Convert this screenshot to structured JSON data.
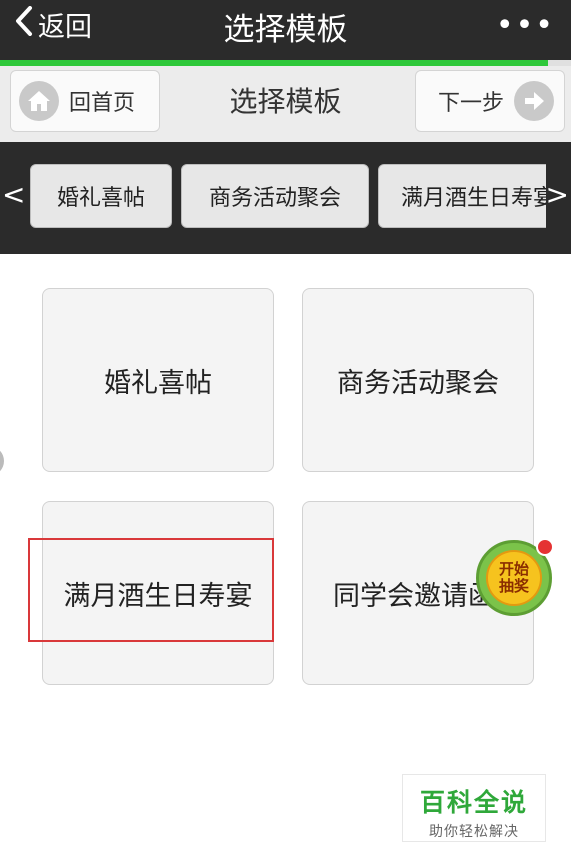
{
  "header": {
    "back_label": "返回",
    "title": "选择模板",
    "more_label": "•••"
  },
  "progress": {
    "fraction": 0.96,
    "color": "#2ec83a"
  },
  "toolbar": {
    "home_label": "回首页",
    "title": "选择模板",
    "next_label": "下一步"
  },
  "tabs": {
    "prev_label": "<",
    "next_label": ">",
    "items": [
      {
        "label": "婚礼喜帖"
      },
      {
        "label": "商务活动聚会"
      },
      {
        "label": "满月酒生日寿宴"
      }
    ]
  },
  "cards": [
    {
      "label": "婚礼喜帖"
    },
    {
      "label": "商务活动聚会"
    },
    {
      "label": "满月酒生日寿宴",
      "highlighted": true
    },
    {
      "label": "同学会邀请函"
    }
  ],
  "lottery": {
    "line1": "开始",
    "line2": "抽奖"
  },
  "watermark": {
    "title": "百科全说",
    "subtitle": "助你轻松解决"
  },
  "colors": {
    "nav_bg": "#2b2b2b",
    "accent_green": "#2ec83a",
    "highlight_red": "#d9383a"
  },
  "icons": {
    "back": "chevron-left-icon",
    "more": "more-dots-icon",
    "home": "home-icon",
    "next": "arrow-right-icon"
  }
}
